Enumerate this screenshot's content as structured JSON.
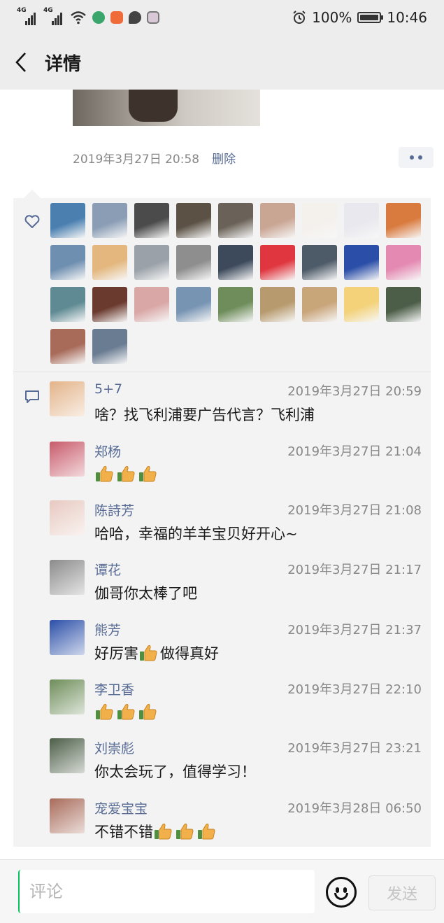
{
  "status_bar": {
    "signal1": "4G",
    "signal2": "4G",
    "battery_percent": "100%",
    "battery_level": 1.0,
    "time": "10:46"
  },
  "nav": {
    "back_icon": "chevron-left-icon",
    "title": "详情"
  },
  "post": {
    "timestamp": "2019年3月27日 20:58",
    "delete_label": "删除"
  },
  "likes": {
    "icon": "heart-outline-icon",
    "avatars": [
      {
        "color": "#4a7fb0"
      },
      {
        "color": "#8a9db5"
      },
      {
        "color": "#4b4b4b"
      },
      {
        "color": "#5b5144"
      },
      {
        "color": "#6a6258"
      },
      {
        "color": "#c9a593"
      },
      {
        "color": "#f4f0ec"
      },
      {
        "color": "#e8e8ee"
      },
      {
        "color": "#d97a3e"
      },
      {
        "color": "#6f8fb0"
      },
      {
        "color": "#e3b77d"
      },
      {
        "color": "#9aa1a8"
      },
      {
        "color": "#8e8e8e"
      },
      {
        "color": "#3d4a5c"
      },
      {
        "color": "#e0363f"
      },
      {
        "color": "#4d5a68"
      },
      {
        "color": "#2b4fa8"
      },
      {
        "color": "#e48ab2"
      },
      {
        "color": "#5f8a93"
      },
      {
        "color": "#6b3a2e"
      },
      {
        "color": "#d9a7a6"
      },
      {
        "color": "#7794b3"
      },
      {
        "color": "#6e8d5a"
      },
      {
        "color": "#b79a6d"
      },
      {
        "color": "#c9a57a"
      },
      {
        "color": "#f3d27a"
      },
      {
        "color": "#4c5e48"
      },
      {
        "color": "#a86b5a"
      },
      {
        "color": "#6a7c92"
      }
    ]
  },
  "comments": {
    "icon": "comment-bubble-icon",
    "items": [
      {
        "name": "5+7",
        "time": "2019年3月27日 20:59",
        "text": "啥？找飞利浦要广告代言？飞利浦",
        "thumbs": 0,
        "avatar_color": "#e3b389"
      },
      {
        "name": "郑杨",
        "time": "2019年3月27日 21:04",
        "text": "",
        "thumbs": 3,
        "avatar_color": "#c85a6a"
      },
      {
        "name": "陈詩芳",
        "time": "2019年3月27日 21:08",
        "text": "哈哈，幸福的羊羊宝贝好开心~",
        "thumbs": 0,
        "avatar_color": "#e7c9c0"
      },
      {
        "name": "谭花",
        "time": "2019年3月27日 21:17",
        "text": "伽哥你太棒了吧",
        "thumbs": 0,
        "avatar_color": "#8b8b8b"
      },
      {
        "name": "熊芳",
        "time": "2019年3月27日 21:37",
        "text_before": "好厉害",
        "text_after": "做得真好",
        "thumbs": 1,
        "avatar_color": "#2b4fa8"
      },
      {
        "name": "李卫香",
        "time": "2019年3月27日 22:10",
        "text": "",
        "thumbs": 3,
        "avatar_color": "#6e8d5a"
      },
      {
        "name": "刘崇彪",
        "time": "2019年3月27日 23:21",
        "text": "你太会玩了，值得学习！",
        "thumbs": 0,
        "avatar_color": "#4c5e48"
      },
      {
        "name": "宠爱宝宝",
        "time": "2019年3月28日 06:50",
        "text": "不错不错",
        "thumbs": 3,
        "avatar_color": "#a86b5a"
      }
    ]
  },
  "input": {
    "placeholder": "评论",
    "emoji_icon": "smiley-face-icon",
    "send_label": "发送"
  }
}
